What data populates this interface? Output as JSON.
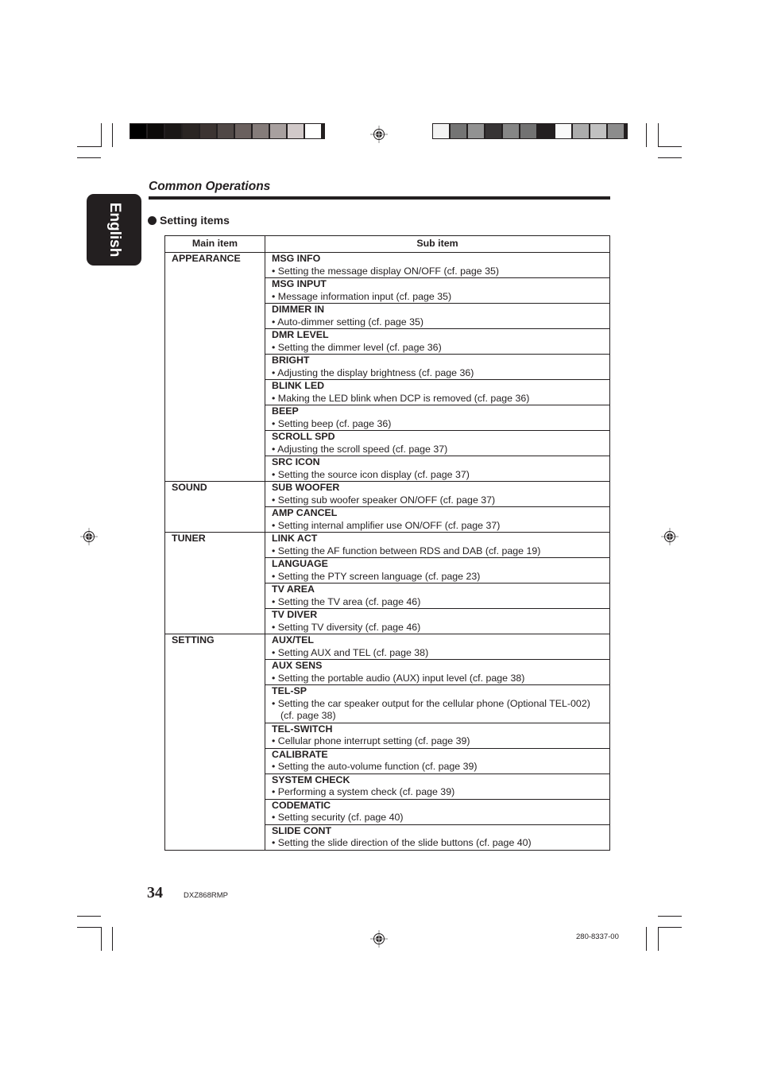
{
  "color_bars": {
    "left": [
      "#000000",
      "#0c0a09",
      "#1a1716",
      "#2a2523",
      "#3c3432",
      "#504846",
      "#6a605e",
      "#857c7a",
      "#a8a09f",
      "#d1c9c9",
      "#ffffff"
    ],
    "right": [
      "#f3f3f3",
      "#747474",
      "#929292",
      "#373435",
      "#868686",
      "#727272",
      "#231f20",
      "#f9f9f9",
      "#acacac",
      "#c1c1c1",
      "#8c8c8c"
    ]
  },
  "language_tab": "English",
  "section_title": "Common Operations",
  "subheading": "Setting items",
  "table": {
    "headers": {
      "main": "Main item",
      "sub": "Sub item"
    },
    "groups": [
      {
        "main": "APPEARANCE",
        "subs": [
          {
            "name": "MSG INFO",
            "desc": "•  Setting the message display ON/OFF (cf. page 35)"
          },
          {
            "name": "MSG INPUT",
            "desc": "•  Message information input (cf. page 35)"
          },
          {
            "name": "DIMMER IN",
            "desc": "•  Auto-dimmer setting (cf. page 35)"
          },
          {
            "name": "DMR LEVEL",
            "desc": "•  Setting the dimmer level (cf. page 36)"
          },
          {
            "name": "BRIGHT",
            "desc": "•  Adjusting the display brightness (cf. page 36)"
          },
          {
            "name": "BLINK LED",
            "desc": "•  Making the LED blink when DCP is removed (cf. page 36)"
          },
          {
            "name": "BEEP",
            "desc": "•  Setting beep (cf. page 36)"
          },
          {
            "name": "SCROLL SPD",
            "desc": "•  Adjusting the scroll speed (cf. page 37)"
          },
          {
            "name": "SRC ICON",
            "desc": "•  Setting the source icon display (cf. page 37)"
          }
        ]
      },
      {
        "main": "SOUND",
        "subs": [
          {
            "name": "SUB WOOFER",
            "desc": "•  Setting sub woofer speaker ON/OFF (cf. page 37)"
          },
          {
            "name": "AMP CANCEL",
            "desc": "•  Setting internal amplifier use ON/OFF (cf. page 37)"
          }
        ]
      },
      {
        "main": "TUNER",
        "subs": [
          {
            "name": "LINK ACT",
            "desc": "•  Setting the AF function between RDS and DAB (cf. page 19)"
          },
          {
            "name": "LANGUAGE",
            "desc": "•  Setting the PTY screen language (cf. page 23)"
          },
          {
            "name": "TV AREA",
            "desc": "•  Setting the TV area (cf. page 46)"
          },
          {
            "name": "TV DIVER",
            "desc": "•  Setting TV diversity (cf. page 46)"
          }
        ]
      },
      {
        "main": "SETTING",
        "subs": [
          {
            "name": "AUX/TEL",
            "desc": "•  Setting AUX and TEL (cf. page 38)"
          },
          {
            "name": "AUX SENS",
            "desc": "•  Setting the portable audio (AUX) input level (cf. page 38)"
          },
          {
            "name": "TEL-SP",
            "desc": "•  Setting the car speaker output for the cellular phone (Optional TEL-002) (cf. page 38)"
          },
          {
            "name": "TEL-SWITCH",
            "desc": "•  Cellular phone interrupt setting (cf. page 39)"
          },
          {
            "name": "CALIBRATE",
            "desc": "•  Setting the auto-volume function (cf. page 39)"
          },
          {
            "name": "SYSTEM CHECK",
            "desc": "•  Performing a system check (cf. page 39)"
          },
          {
            "name": "CODEMATIC",
            "desc": "•  Setting security (cf. page 40)"
          },
          {
            "name": "SLIDE CONT",
            "desc": "•  Setting the slide direction of the slide buttons (cf. page 40)"
          }
        ]
      }
    ]
  },
  "footer": {
    "page_number": "34",
    "model": "DXZ868RMP",
    "doc_code": "280-8337-00"
  }
}
